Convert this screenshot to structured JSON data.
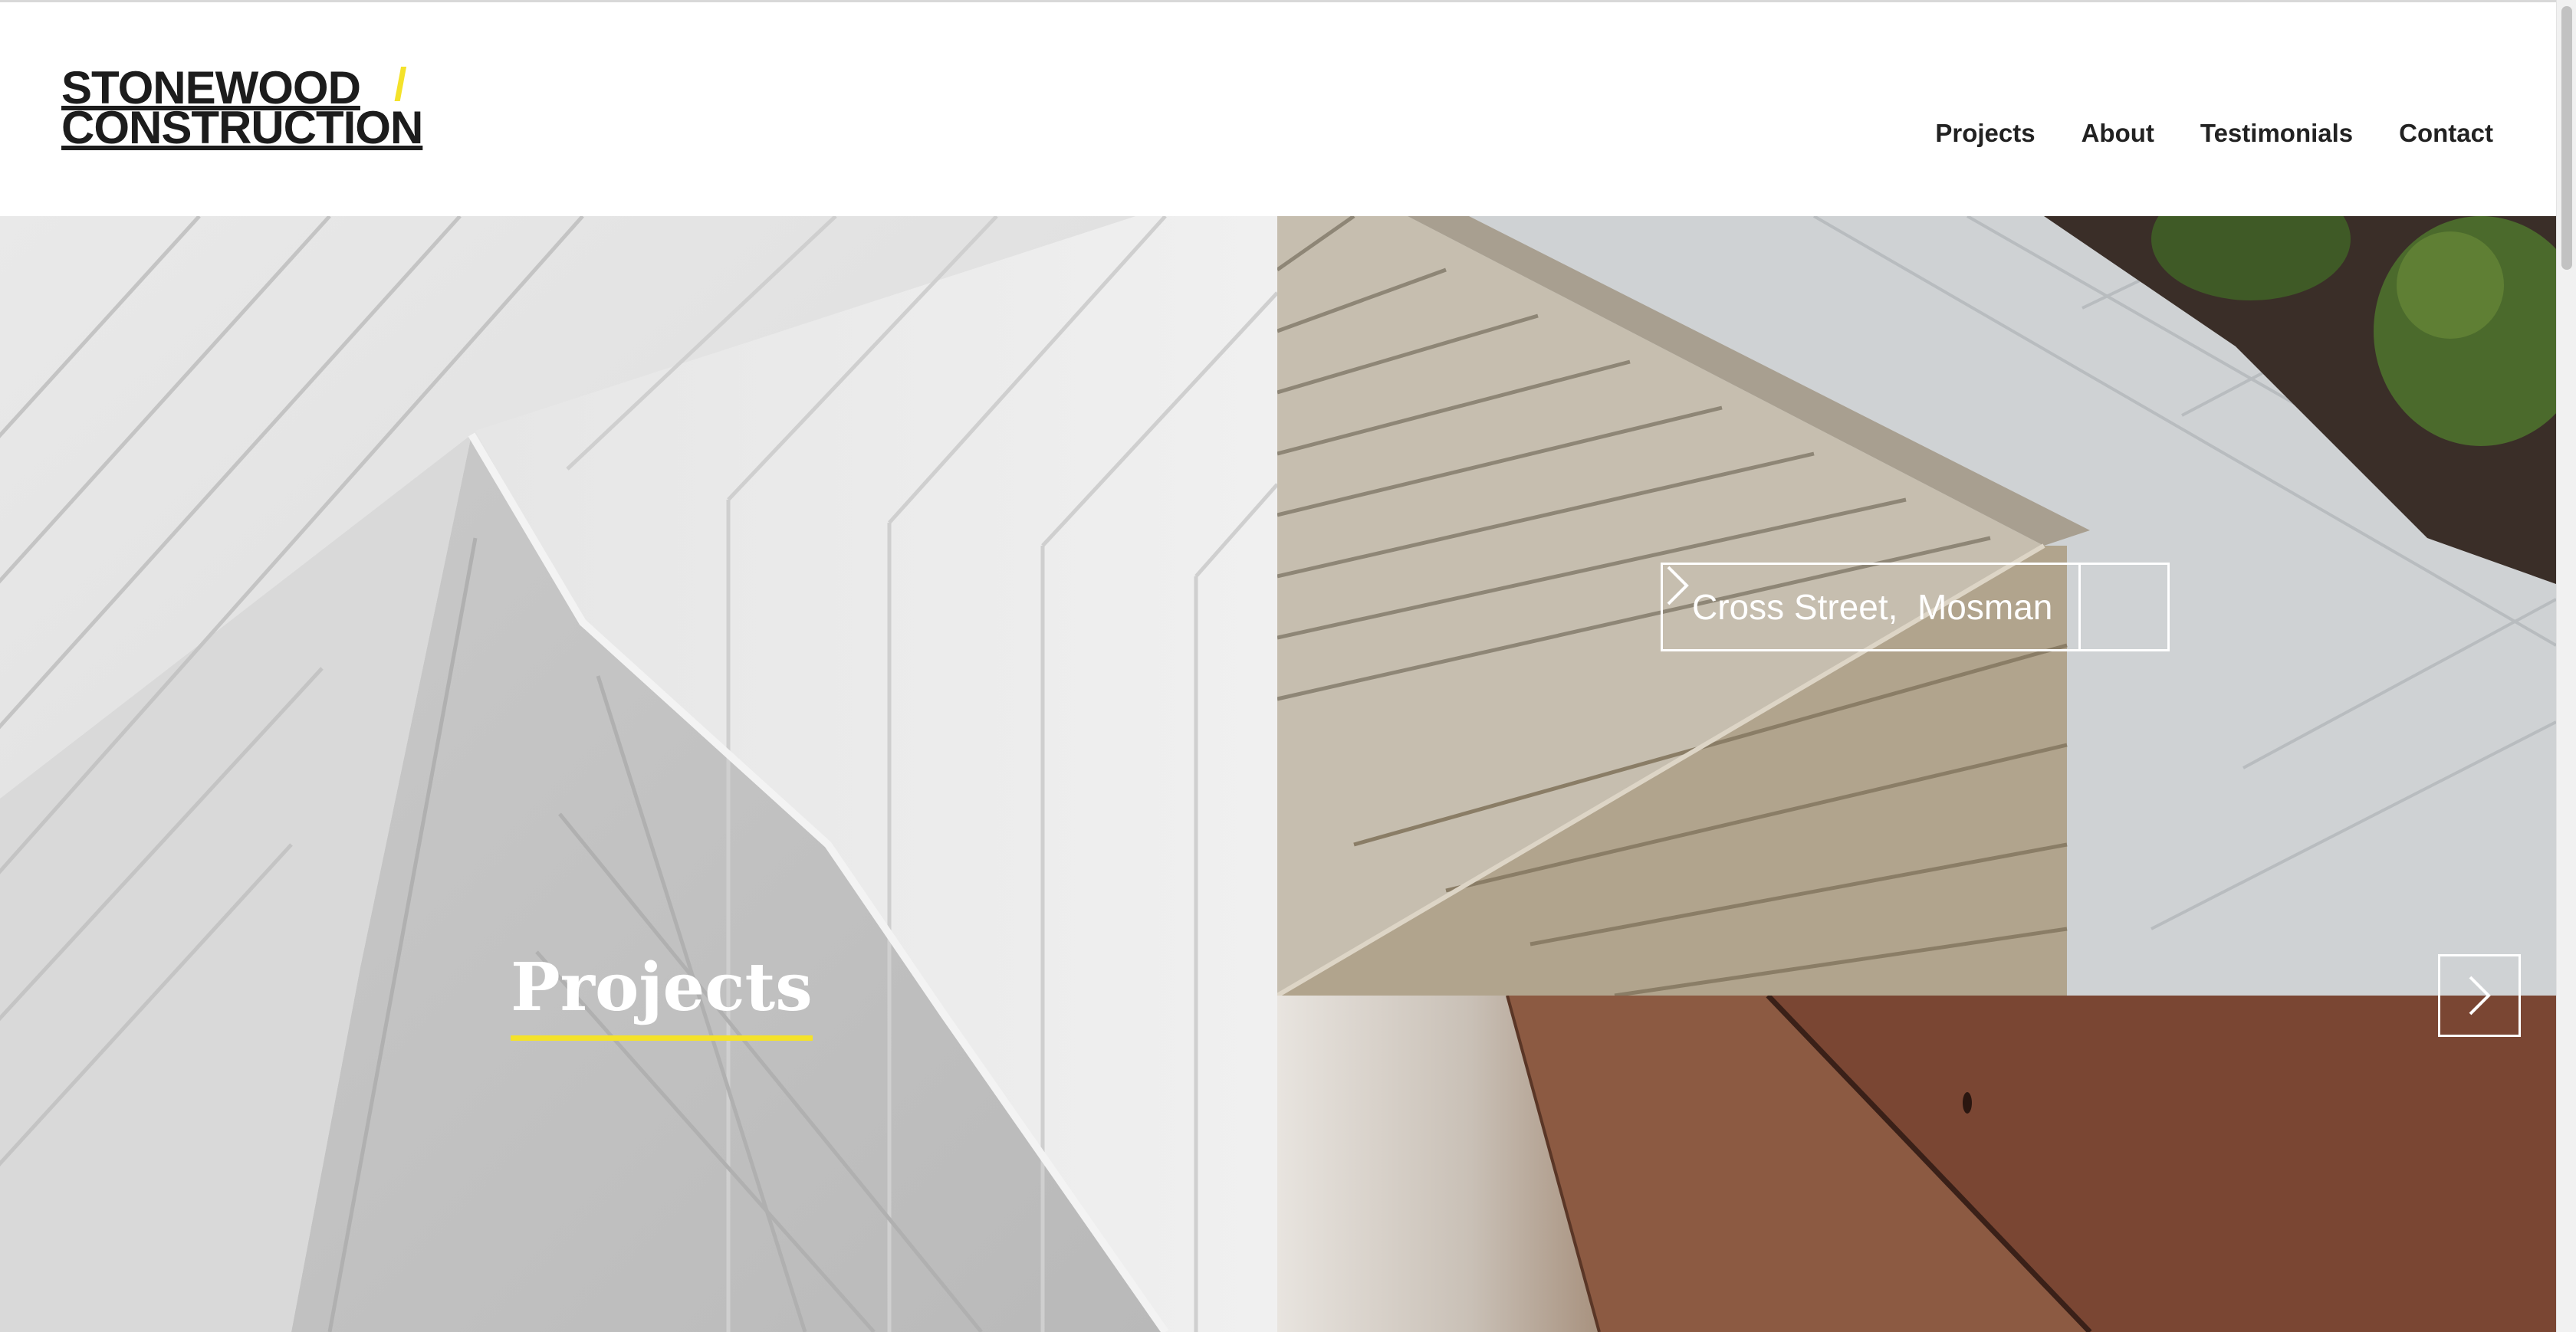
{
  "brand": {
    "line1": "STONEWOOD",
    "line2": "CONSTRUCTION",
    "slash": "/",
    "accent_color": "#f4e22a"
  },
  "nav": {
    "projects": "Projects",
    "about": "About",
    "testimonials": "Testimonials",
    "contact": "Contact"
  },
  "hero": {
    "title": "Projects",
    "underline_color": "#f4e22a"
  },
  "featured_project": {
    "label": "Cross Street,  Mosman",
    "arrow_icon": "chevron-right-icon"
  },
  "slider": {
    "next_icon": "chevron-right-icon"
  }
}
